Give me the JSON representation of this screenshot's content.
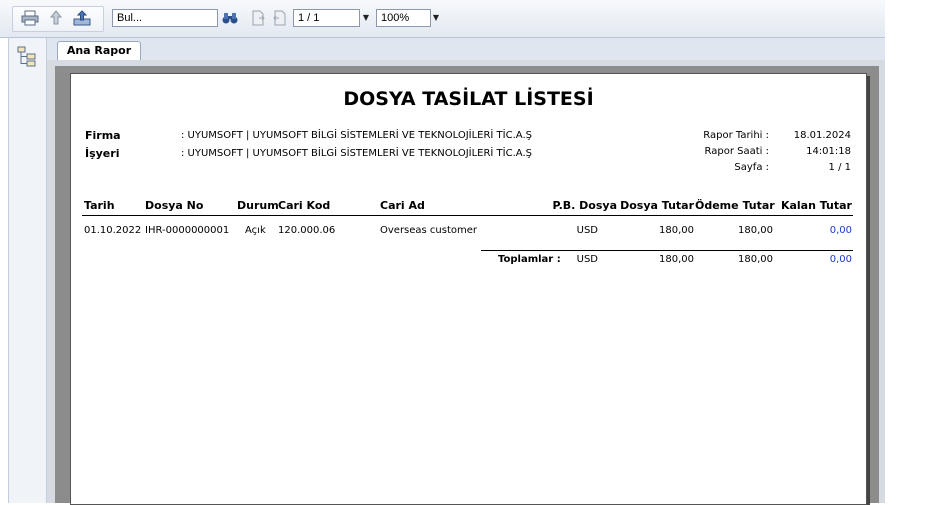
{
  "toolbar": {
    "search_value": "Bul...",
    "page_value": "1 / 1",
    "zoom_value": "100%"
  },
  "tabs": [
    {
      "label": "Ana Rapor"
    }
  ],
  "report": {
    "title": "DOSYA TASİLAT LİSTESİ",
    "firma_label": "Firma",
    "isyeri_label": "İşyeri",
    "firma_value": ": UYUMSOFT | UYUMSOFT BİLGİ SİSTEMLERİ VE TEKNOLOJİLERİ TİC.A.Ş",
    "isyeri_value": ": UYUMSOFT | UYUMSOFT BİLGİ SİSTEMLERİ VE TEKNOLOJİLERİ TİC.A.Ş",
    "meta": [
      {
        "label": "Rapor Tarihi  :",
        "value": "18.01.2024"
      },
      {
        "label": "Rapor Saati  :",
        "value": "14:01:18"
      },
      {
        "label": "Sayfa  :",
        "value": "1 / 1"
      }
    ],
    "columns": {
      "tarih": "Tarih",
      "dosya_no": "Dosya No",
      "durum": "Durum",
      "cari_kod": "Cari Kod",
      "cari_ad": "Cari Ad",
      "pb_dosya": "P.B. Dosya",
      "dosya_tutar": "Dosya Tutar",
      "odeme_tutar": "Ödeme Tutar",
      "kalan_tutar": "Kalan Tutar"
    },
    "rows": [
      {
        "tarih": "01.10.2022",
        "dosya_no": "IHR-0000000001",
        "durum": "Açık",
        "cari_kod": "120.000.06",
        "cari_ad": "Overseas customer",
        "pb_dosya": "USD",
        "dosya_tutar": "180,00",
        "odeme_tutar": "180,00",
        "kalan_tutar": "0,00"
      }
    ],
    "totals": {
      "label": "Toplamlar :",
      "pb_dosya": "USD",
      "dosya_tutar": "180,00",
      "odeme_tutar": "180,00",
      "kalan_tutar": "0,00"
    }
  }
}
